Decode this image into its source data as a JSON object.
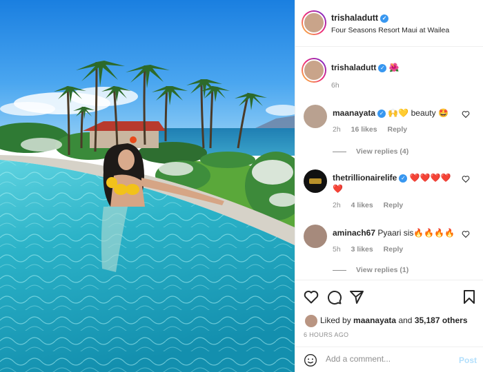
{
  "post": {
    "username": "trishaladutt",
    "location": "Four Seasons Resort Maui at Wailea"
  },
  "caption": {
    "username": "trishaladutt",
    "text": "🌺",
    "time": "6h"
  },
  "comments": [
    {
      "username": "maanayata",
      "text": "🙌💛 beauty 🤩",
      "time": "2h",
      "likes": "16 likes",
      "reply": "Reply",
      "view_replies": "View replies (4)"
    },
    {
      "username": "thetrillionairelife",
      "text": "❤️❤️❤️❤️❤️",
      "time": "2h",
      "likes": "4 likes",
      "reply": "Reply"
    },
    {
      "username": "aminach67",
      "text": "Pyaari sis🔥🔥🔥🔥",
      "time": "5h",
      "likes": "3 likes",
      "reply": "Reply",
      "view_replies": "View replies (1)"
    }
  ],
  "likes": {
    "prefix": "Liked by",
    "user": "maanayata",
    "connector": "and",
    "others": "35,187 others"
  },
  "timestamp": "6 HOURS AGO",
  "add_comment": {
    "placeholder": "Add a comment...",
    "post_label": "Post"
  },
  "icons": [
    "more-icon",
    "heart-icon",
    "comment-icon",
    "share-icon",
    "bookmark-icon",
    "emoji-icon",
    "verified-badge"
  ],
  "colors": {
    "link": "#3897f0",
    "post_disabled": "#b2dffc",
    "muted": "#8e8e8e",
    "heart_red": "#ed4956"
  }
}
